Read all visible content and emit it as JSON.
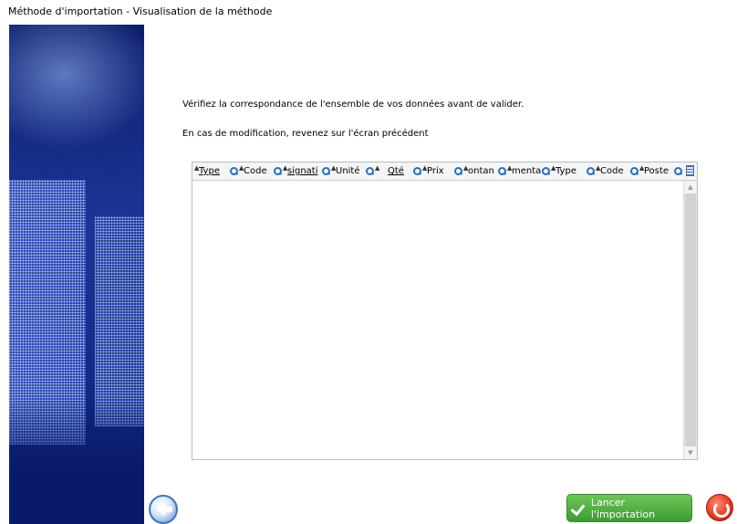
{
  "window": {
    "title": "Méthode d'importation - Visualisation de la méthode"
  },
  "instructions": {
    "line1": "Vérifiez la correspondance de l'ensemble de vos données avant de valider.",
    "line2": "En cas de modification, revenez sur l'écran précédent"
  },
  "grid": {
    "columns": [
      {
        "label": "Type",
        "underlined": true
      },
      {
        "label": "Code",
        "underlined": false
      },
      {
        "label": "signati",
        "underlined": true
      },
      {
        "label": "Unité",
        "underlined": false
      },
      {
        "label": "Qté",
        "underlined": true
      },
      {
        "label": "Prix",
        "underlined": false
      },
      {
        "label": "ontan",
        "underlined": false
      },
      {
        "label": "menta",
        "underlined": false
      },
      {
        "label": "Type",
        "underlined": false
      },
      {
        "label": "Code",
        "underlined": false
      },
      {
        "label": "Poste",
        "underlined": false
      }
    ],
    "rows": [],
    "sort_icon": "sort-arrows-icon",
    "search_icon": "magnifier-icon",
    "settings_icon": "column-settings-icon"
  },
  "footer": {
    "back_icon": "back-arrow-icon",
    "launch_label": "Lancer l'importation",
    "cancel_icon": "cancel-icon"
  },
  "colors": {
    "launch_green": "#4caf3f",
    "cancel_red": "#e23b22",
    "banner_blue": "#1d3596"
  }
}
